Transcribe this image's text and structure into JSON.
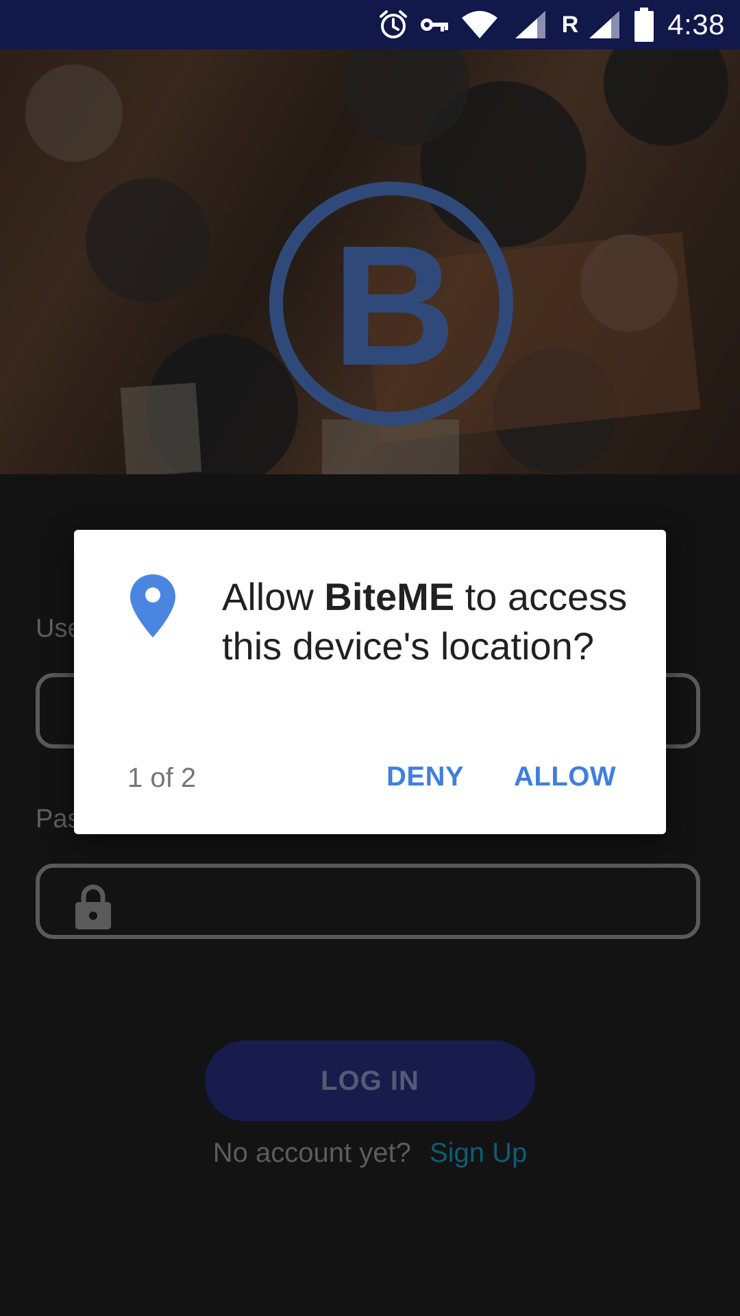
{
  "status_bar": {
    "time": "4:38",
    "roaming_indicator": "R",
    "icons": [
      "alarm-icon",
      "vpn-key-icon",
      "wifi-icon",
      "signal-icon",
      "signal-roaming-icon",
      "battery-icon"
    ],
    "background": "#11184a"
  },
  "hero": {
    "logo_letter": "B",
    "logo_color": "#2f4a7a"
  },
  "login_form": {
    "username_label": "Use",
    "password_label": "Pas",
    "login_button": "LOG IN",
    "no_account_text": "No account yet?",
    "signup_link": "Sign Up",
    "accent_color": "#171c4d"
  },
  "permission_dialog": {
    "message_prefix": "Allow ",
    "app_name": "BiteME",
    "message_suffix": " to access this device's location?",
    "counter": "1 of 2",
    "deny_label": "DENY",
    "allow_label": "ALLOW",
    "button_color": "#3f7fdc",
    "icon": "location-pin-icon"
  }
}
